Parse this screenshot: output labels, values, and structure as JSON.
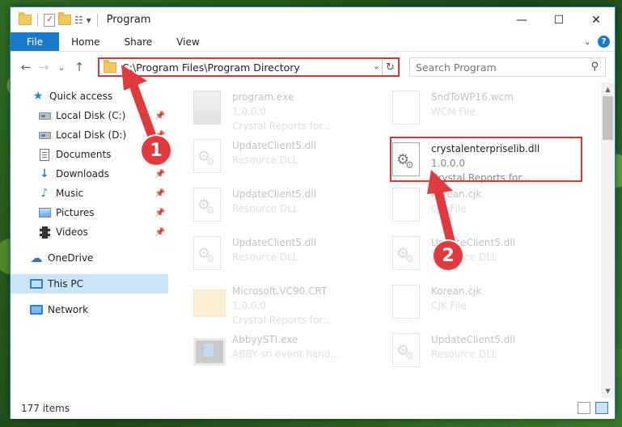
{
  "window": {
    "title": "Program",
    "controls": {
      "minimize": "—",
      "maximize": "☐",
      "close": "✕"
    }
  },
  "ribbon": {
    "tabs": [
      "File",
      "Home",
      "Share",
      "View"
    ],
    "help": "?"
  },
  "nav": {
    "back": "←",
    "forward": "→",
    "recent": "⌄",
    "up": "↑"
  },
  "address": {
    "path": "C:\\Program Files\\Program Directory",
    "dropdown": "⌄",
    "refresh": "↻"
  },
  "search": {
    "placeholder": "Search Program",
    "icon": "⚲"
  },
  "sidebar": {
    "items": [
      {
        "label": "Quick access",
        "icon": "star-icon"
      },
      {
        "label": "Local Disk (C:)",
        "icon": "drive-icon",
        "pinned": true
      },
      {
        "label": "Local Disk (D:)",
        "icon": "drive-icon",
        "pinned": true
      },
      {
        "label": "Documents",
        "icon": "documents-icon",
        "pinned": true
      },
      {
        "label": "Downloads",
        "icon": "downloads-icon",
        "pinned": true
      },
      {
        "label": "Music",
        "icon": "music-icon",
        "pinned": true
      },
      {
        "label": "Pictures",
        "icon": "pictures-icon",
        "pinned": true
      },
      {
        "label": "Videos",
        "icon": "videos-icon",
        "pinned": true
      },
      {
        "label": "OneDrive",
        "icon": "cloud-icon"
      },
      {
        "label": "This PC",
        "icon": "computer-icon",
        "selected": true
      },
      {
        "label": "Network",
        "icon": "network-icon"
      }
    ],
    "pin_glyph": "📌"
  },
  "files": [
    {
      "name": "program.exe",
      "sub1": "1.0.0.0",
      "sub2": "Crystal Reports for...",
      "icon": "exe",
      "faded": true
    },
    {
      "name": "SndToWP16.wcm",
      "sub1": "WCM File",
      "sub2": "",
      "icon": "blank",
      "faded": true
    },
    {
      "name": "UpdateClient5.dll",
      "sub1": "Resource DLL",
      "sub2": "",
      "icon": "dll",
      "faded": true
    },
    {
      "name": "crystalenterpriselib.dll",
      "sub1": "1.0.0.0",
      "sub2": "Crystal Reports for...",
      "icon": "dll",
      "faded": false
    },
    {
      "name": "UpdateClient5.dll",
      "sub1": "Resource DLL",
      "sub2": "",
      "icon": "dll",
      "faded": true
    },
    {
      "name": "Korean.cjk",
      "sub1": "CJK File",
      "sub2": "",
      "icon": "blank",
      "faded": true
    },
    {
      "name": "UpdateClient5.dll",
      "sub1": "Resource DLL",
      "sub2": "",
      "icon": "dll",
      "faded": true
    },
    {
      "name": "UpdateClient5.dll",
      "sub1": "Resource DLL",
      "sub2": "",
      "icon": "dll",
      "faded": true
    },
    {
      "name": "Microsoft.VC90.CRT",
      "sub1": "1.0.0.0",
      "sub2": "Crystal Reports for...",
      "icon": "folder",
      "faded": true
    },
    {
      "name": "Korean.cjk",
      "sub1": "CJK File",
      "sub2": "",
      "icon": "blank",
      "faded": true
    },
    {
      "name": "AbbyySTI.exe",
      "sub1": "ABBY sti event hand...",
      "sub2": "",
      "icon": "abby",
      "faded": true
    },
    {
      "name": "UpdateClient5.dll",
      "sub1": "Resource DLL",
      "sub2": "",
      "icon": "dll",
      "faded": true
    }
  ],
  "status": {
    "count": "177 items"
  },
  "callouts": {
    "one": "1",
    "two": "2"
  },
  "colors": {
    "accent": "#1979ca",
    "highlight": "#d9343a",
    "callout": "#e0393e",
    "selected": "#cce4f7"
  }
}
